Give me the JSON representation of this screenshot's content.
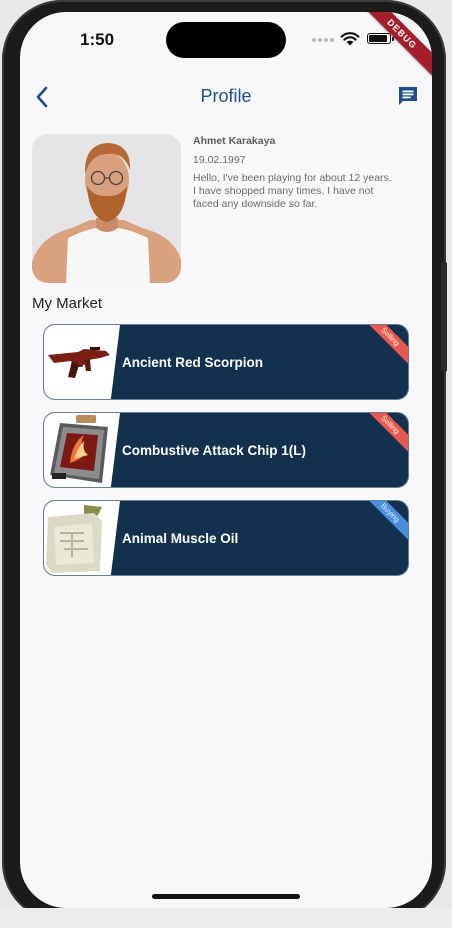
{
  "status_bar": {
    "time": "1:50",
    "debug_label": "DEBUG",
    "icons": [
      "signal-icon",
      "wifi-icon",
      "battery-icon"
    ]
  },
  "nav": {
    "title": "Profile",
    "back_icon": "chevron-left-icon",
    "action_icon": "chat-message-icon"
  },
  "profile": {
    "name": "Ahmet Karakaya",
    "birth_date": "19.02.1997",
    "bio": "Hello, I've been playing for about 12 years. I have shopped many times. I have not faced any downside so far."
  },
  "market": {
    "title": "My Market",
    "items": [
      {
        "name": "Ancient Red Scorpion",
        "tag": "Selling",
        "icon": "red-rifle-icon"
      },
      {
        "name": "Combustive Attack Chip 1(L)",
        "tag": "Selling",
        "icon": "attack-chip-icon"
      },
      {
        "name": "Animal Muscle Oil",
        "tag": "Buying",
        "icon": "oil-canister-icon"
      }
    ]
  },
  "colors": {
    "accent": "#1f4d8f",
    "card_bg": "#12314f",
    "selling_tag": "#e8584d",
    "buying_tag": "#4a8fdc",
    "debug_ribbon": "#a3202b"
  }
}
